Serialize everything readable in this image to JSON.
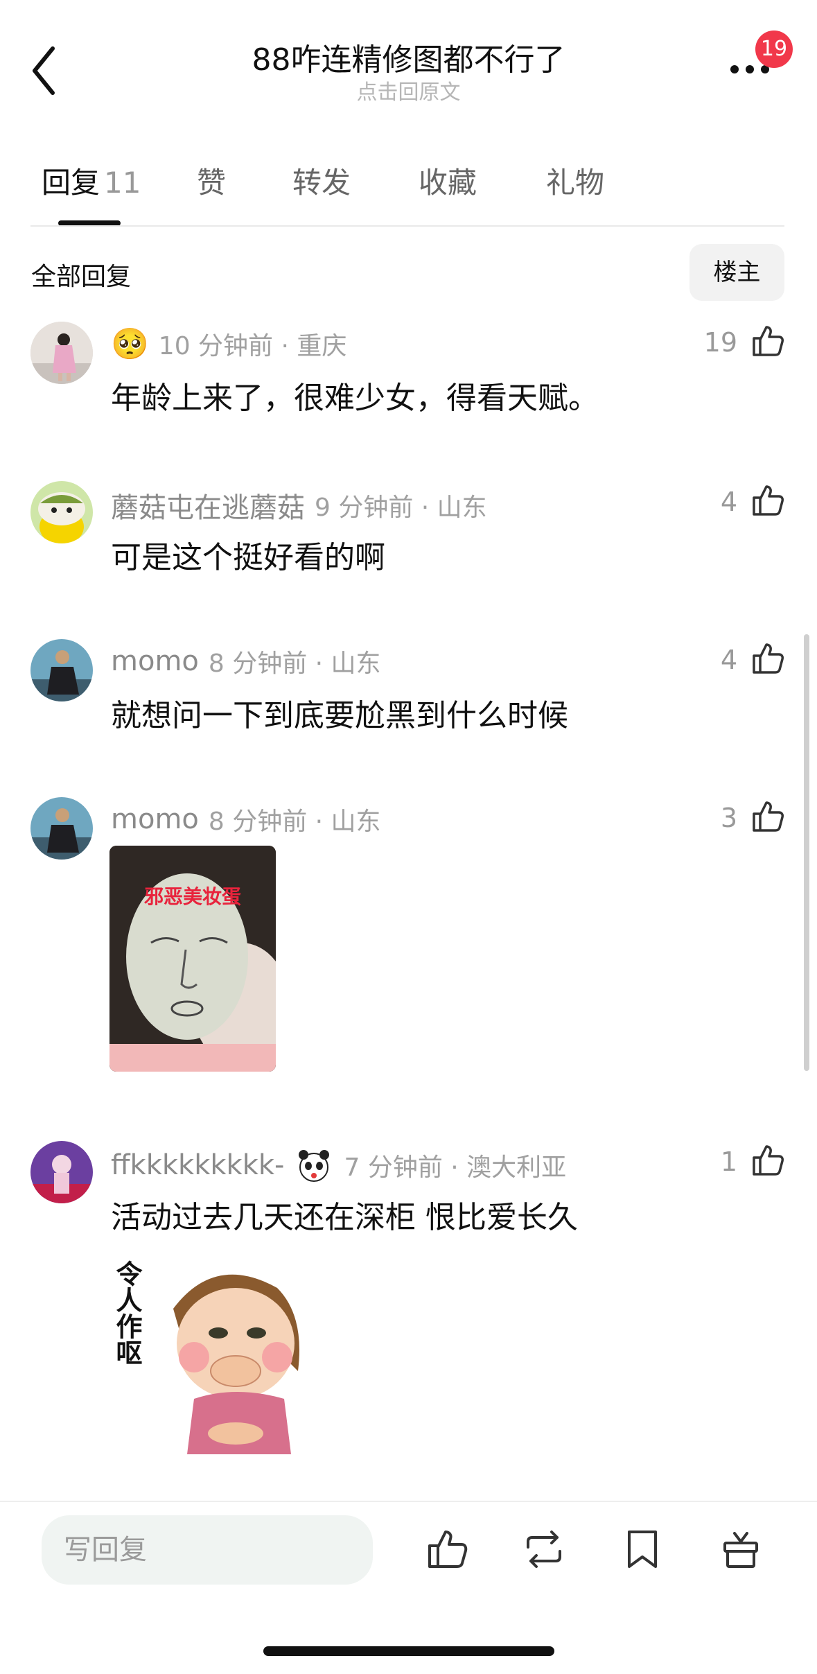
{
  "header": {
    "title": "88咋连精修图都不行了",
    "subtitle": "点击回原文",
    "badge": "19"
  },
  "tabs": [
    {
      "label": "回复",
      "count": "11"
    },
    {
      "label": "赞"
    },
    {
      "label": "转发"
    },
    {
      "label": "收藏"
    },
    {
      "label": "礼物"
    }
  ],
  "section": {
    "title": "全部回复",
    "owner_button": "楼主"
  },
  "comments": [
    {
      "username": "",
      "emoji_badge": "🥺",
      "time": "10 分钟前 · 重庆",
      "text": "年龄上来了，很难少女，得看天赋。",
      "likes": "19"
    },
    {
      "username": "蘑菇屯在逃蘑菇",
      "time": "9 分钟前 · 山东",
      "text": "可是这个挺好看的啊",
      "likes": "4"
    },
    {
      "username": "momo",
      "time": "8 分钟前 · 山东",
      "text": "就想问一下到底要尬黑到什么时候",
      "likes": "4"
    },
    {
      "username": "momo",
      "time": "8 分钟前 · 山东",
      "text": "",
      "image_caption": "邪恶美妆蛋",
      "likes": "3"
    },
    {
      "username": "ffkkkkkkkkk-",
      "time": "7 分钟前 · 澳大利亚",
      "text": "活动过去几天还在深柜 恨比爱长久",
      "image_caption": "令人作呕",
      "likes": "1"
    }
  ],
  "bottom_bar": {
    "reply_placeholder": "写回复"
  },
  "colors": {
    "badge": "#f1384a",
    "accent_text": "#111111",
    "muted": "#a0a0a0"
  }
}
